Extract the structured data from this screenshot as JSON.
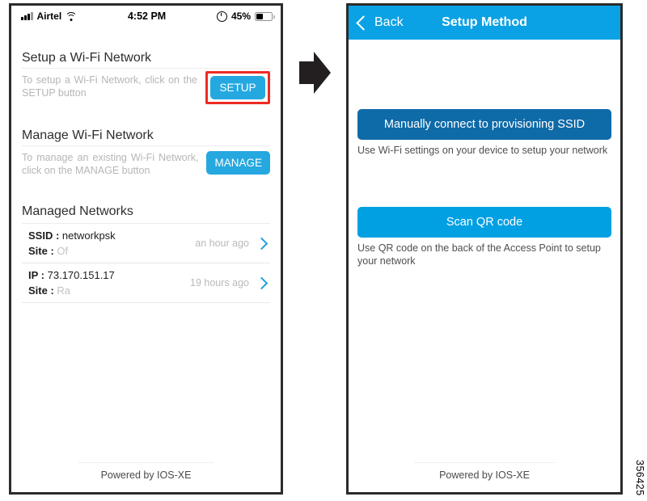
{
  "figure_id": "356425",
  "colors": {
    "accent_blue": "#25a8e0",
    "navbar_blue": "#0aa2e4",
    "dark_blue_button": "#0f6aa8",
    "light_blue_button": "#00a0e3",
    "highlight_red": "#ee2b24",
    "muted_text": "#b6b6b6"
  },
  "arrow": {
    "name": "flow-arrow",
    "direction": "right"
  },
  "left_phone": {
    "status_bar": {
      "carrier": "Airtel",
      "signal_icon": "signal-bars-icon",
      "wifi_icon": "wifi-icon",
      "time": "4:52 PM",
      "lock_icon": "orientation-lock-icon",
      "battery_percent": "45%",
      "battery_level": 45,
      "battery_icon": "battery-icon"
    },
    "setup_section": {
      "title": "Setup a Wi-Fi Network",
      "description": "To setup a Wi-Fi Network, click on the SETUP button",
      "button_label": "SETUP",
      "highlighted": true
    },
    "manage_section": {
      "title": "Manage Wi-Fi Network",
      "description": "To manage an existing Wi-Fi Network, click on the MANAGE button",
      "button_label": "MANAGE",
      "highlighted": false
    },
    "managed_networks": {
      "title": "Managed Networks",
      "rows": [
        {
          "line1_label": "SSID :",
          "line1_value": "networkpsk",
          "line2_label": "Site :",
          "line2_value": "Of",
          "time": "an hour ago",
          "chevron_icon": "chevron-right-icon"
        },
        {
          "line1_label": "IP :",
          "line1_value": "73.170.151.17",
          "line2_label": "Site :",
          "line2_value": "Ra",
          "time": "19 hours ago",
          "chevron_icon": "chevron-right-icon"
        }
      ]
    },
    "footer": "Powered by IOS-XE"
  },
  "right_phone": {
    "navbar": {
      "back_label": "Back",
      "back_icon": "chevron-left-icon",
      "title": "Setup Method"
    },
    "options": [
      {
        "button_label": "Manually connect to provisioning SSID",
        "help_text": "Use Wi-Fi settings on your device to setup your network",
        "style": "dark"
      },
      {
        "button_label": "Scan QR code",
        "help_text": "Use QR code on the back of the Access Point to setup your network",
        "style": "light"
      }
    ],
    "footer": "Powered by IOS-XE"
  }
}
